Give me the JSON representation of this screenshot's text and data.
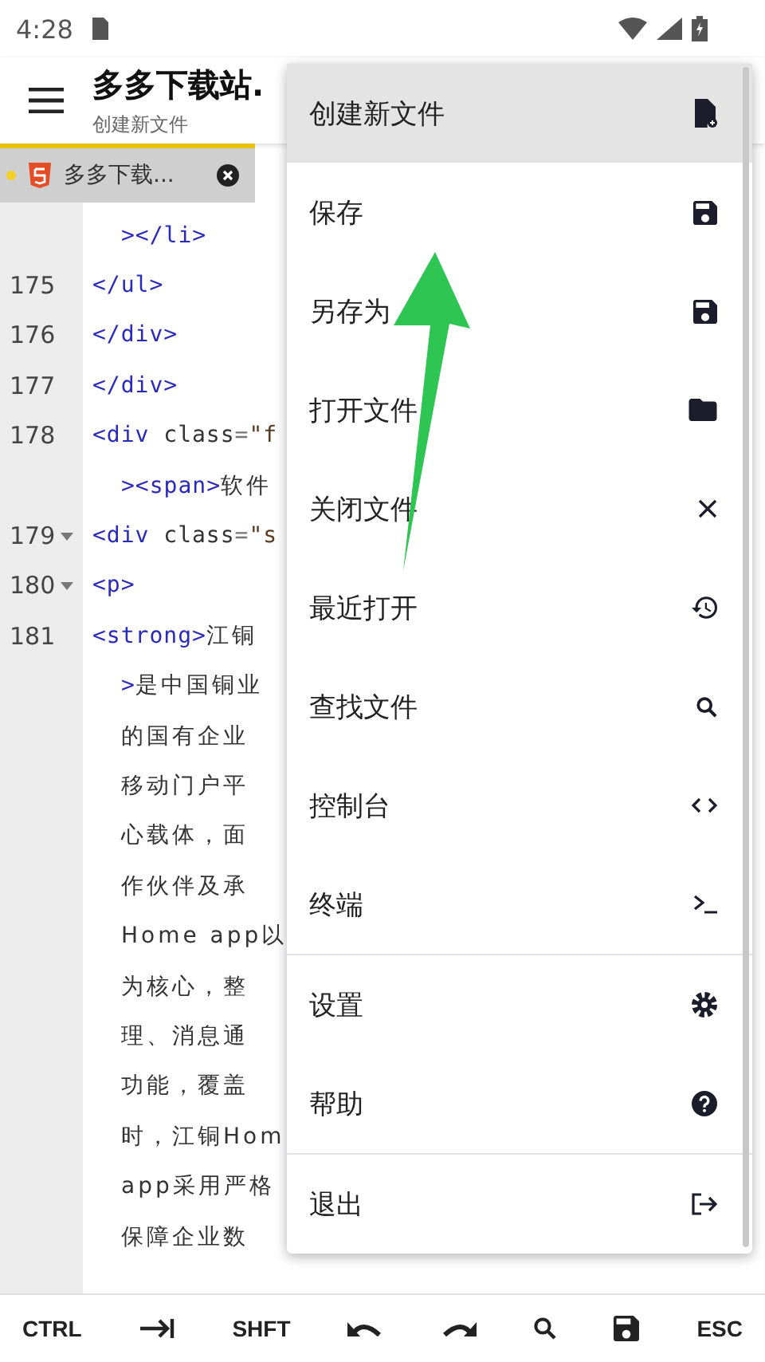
{
  "status_bar": {
    "time": "4:28"
  },
  "app_bar": {
    "title": "多多下载站.",
    "subtitle": "创建新文件"
  },
  "tabs": [
    {
      "label": "多多下载...",
      "modified": true,
      "selected": true
    }
  ],
  "editor": {
    "lines": [
      {
        "indent": true,
        "tokens": [
          {
            "kind": "tag",
            "text": "></li>"
          }
        ]
      },
      {
        "number": "175",
        "indent": false,
        "tokens": [
          {
            "kind": "tag",
            "text": "</ul>"
          }
        ]
      },
      {
        "number": "176",
        "indent": false,
        "tokens": [
          {
            "kind": "tag",
            "text": "</div>"
          }
        ]
      },
      {
        "number": "177",
        "indent": false,
        "tokens": [
          {
            "kind": "tag",
            "text": "</div>"
          }
        ]
      },
      {
        "number": "178",
        "indent": false,
        "tokens": [
          {
            "kind": "tag",
            "text": "<div"
          },
          {
            "kind": "attr",
            "text": " class"
          },
          {
            "kind": "punct",
            "text": "="
          },
          {
            "kind": "string",
            "text": "\"f"
          }
        ]
      },
      {
        "indent": true,
        "tokens": [
          {
            "kind": "tag",
            "text": "><span>"
          },
          {
            "kind": "text",
            "text": "软件"
          }
        ]
      },
      {
        "number": "179",
        "foldable": true,
        "indent": false,
        "tokens": [
          {
            "kind": "tag",
            "text": "<div"
          },
          {
            "kind": "attr",
            "text": " class"
          },
          {
            "kind": "punct",
            "text": "="
          },
          {
            "kind": "string",
            "text": "\"s"
          }
        ]
      },
      {
        "number": "180",
        "foldable": true,
        "indent": false,
        "tokens": [
          {
            "kind": "tag",
            "text": "<p>"
          }
        ]
      },
      {
        "number": "181",
        "indent": false,
        "tokens": [
          {
            "kind": "tag",
            "text": "<strong>"
          },
          {
            "kind": "text",
            "text": "江铜"
          }
        ]
      },
      {
        "indent": true,
        "tokens": [
          {
            "kind": "tag",
            "text": ">"
          },
          {
            "kind": "text",
            "text": "是中国铜业"
          }
        ]
      },
      {
        "indent": true,
        "tokens": [
          {
            "kind": "text",
            "text": "的国有企业"
          }
        ]
      },
      {
        "indent": true,
        "tokens": [
          {
            "kind": "text",
            "text": "移动门户平"
          }
        ]
      },
      {
        "indent": true,
        "tokens": [
          {
            "kind": "text",
            "text": "心载体，面"
          }
        ]
      },
      {
        "indent": true,
        "tokens": [
          {
            "kind": "text",
            "text": "作伙伴及承"
          }
        ]
      },
      {
        "indent": true,
        "tokens": [
          {
            "kind": "text",
            "text": "Home app以"
          }
        ]
      },
      {
        "indent": true,
        "tokens": [
          {
            "kind": "text",
            "text": "为核心，整"
          }
        ]
      },
      {
        "indent": true,
        "tokens": [
          {
            "kind": "text",
            "text": "理、消息通"
          }
        ]
      },
      {
        "indent": true,
        "tokens": [
          {
            "kind": "text",
            "text": "功能，覆盖"
          }
        ]
      },
      {
        "indent": true,
        "tokens": [
          {
            "kind": "text",
            "text": "时，江铜Hom"
          }
        ]
      },
      {
        "indent": true,
        "tokens": [
          {
            "kind": "text",
            "text": "app采用严格"
          }
        ]
      },
      {
        "indent": true,
        "tokens": [
          {
            "kind": "text",
            "text": "保障企业数"
          }
        ]
      }
    ]
  },
  "menu": {
    "groups": [
      [
        {
          "label": "创建新文件",
          "kind": "file-plus",
          "selected": true
        },
        {
          "label": "保存",
          "kind": "save",
          "selected": false
        },
        {
          "label": "另存为",
          "kind": "save",
          "selected": false
        },
        {
          "label": "打开文件",
          "kind": "folder",
          "selected": false
        },
        {
          "label": "关闭文件",
          "kind": "close",
          "selected": false
        },
        {
          "label": "最近打开",
          "kind": "history",
          "selected": false
        },
        {
          "label": "查找文件",
          "kind": "search",
          "selected": false
        },
        {
          "label": "控制台",
          "kind": "code",
          "selected": false
        },
        {
          "label": "终端",
          "kind": "terminal",
          "selected": false
        }
      ],
      [
        {
          "label": "设置",
          "kind": "gear",
          "selected": false
        },
        {
          "label": "帮助",
          "kind": "help",
          "selected": false
        }
      ],
      [
        {
          "label": "退出",
          "kind": "logout",
          "selected": false
        }
      ]
    ]
  },
  "toolbar": [
    {
      "kind": "text",
      "label": "CTRL"
    },
    {
      "kind": "tab"
    },
    {
      "kind": "text",
      "label": "SHFT"
    },
    {
      "kind": "undo"
    },
    {
      "kind": "redo"
    },
    {
      "kind": "search"
    },
    {
      "kind": "save"
    },
    {
      "kind": "text",
      "label": "ESC"
    }
  ]
}
